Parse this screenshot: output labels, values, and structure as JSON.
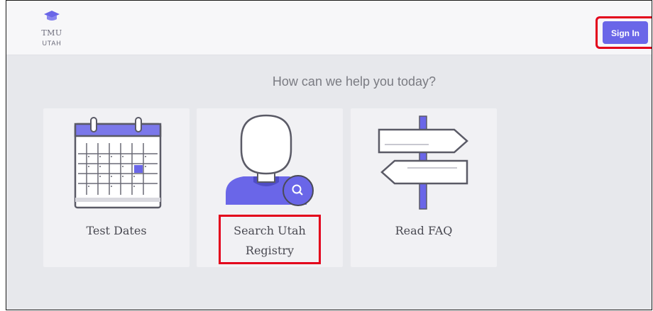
{
  "header": {
    "logo_line1": "TMU",
    "logo_line2": "UTAH",
    "signin_label": "Sign In"
  },
  "main": {
    "heading": "How can we help you today?",
    "cards": [
      {
        "label": "Test Dates",
        "icon": "calendar-icon"
      },
      {
        "label_line1": "Search Utah",
        "label_line2": "Registry",
        "icon": "person-search-icon"
      },
      {
        "label": "Read FAQ",
        "icon": "signpost-icon"
      }
    ]
  },
  "colors": {
    "accent": "#6a66e8",
    "highlight": "#e3001b",
    "background": "#e7e8ec",
    "card": "#f1f1f4"
  }
}
